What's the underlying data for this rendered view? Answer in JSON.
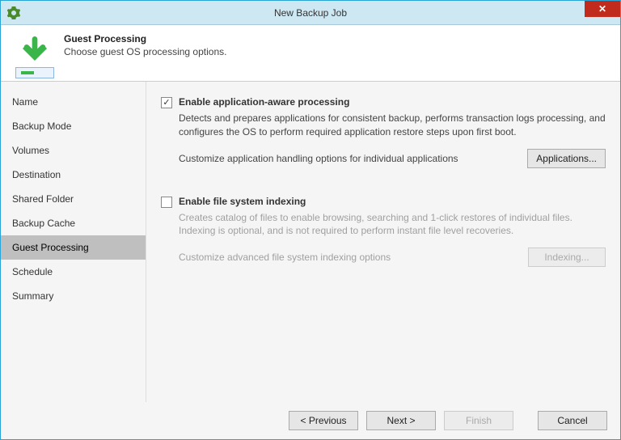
{
  "titlebar": {
    "title": "New Backup Job"
  },
  "header": {
    "title": "Guest Processing",
    "subtitle": "Choose guest OS processing options."
  },
  "sidebar": {
    "items": [
      {
        "label": "Name"
      },
      {
        "label": "Backup Mode"
      },
      {
        "label": "Volumes"
      },
      {
        "label": "Destination"
      },
      {
        "label": "Shared Folder"
      },
      {
        "label": "Backup Cache"
      },
      {
        "label": "Guest Processing"
      },
      {
        "label": "Schedule"
      },
      {
        "label": "Summary"
      }
    ],
    "selectedIndex": 6
  },
  "content": {
    "section1": {
      "checkbox_label": "Enable application-aware processing",
      "checked": true,
      "desc": "Detects and prepares applications for consistent backup, performs transaction logs processing, and configures the OS to perform required application restore steps upon first boot.",
      "customize": "Customize application handling options for individual applications",
      "button": "Applications..."
    },
    "section2": {
      "checkbox_label": "Enable file system indexing",
      "checked": false,
      "desc": "Creates catalog of files to enable browsing, searching and 1-click restores of individual files. Indexing is optional, and is not required to perform instant file level recoveries.",
      "customize": "Customize advanced file system indexing options",
      "button": "Indexing..."
    }
  },
  "footer": {
    "previous": "< Previous",
    "next": "Next >",
    "finish": "Finish",
    "cancel": "Cancel"
  }
}
